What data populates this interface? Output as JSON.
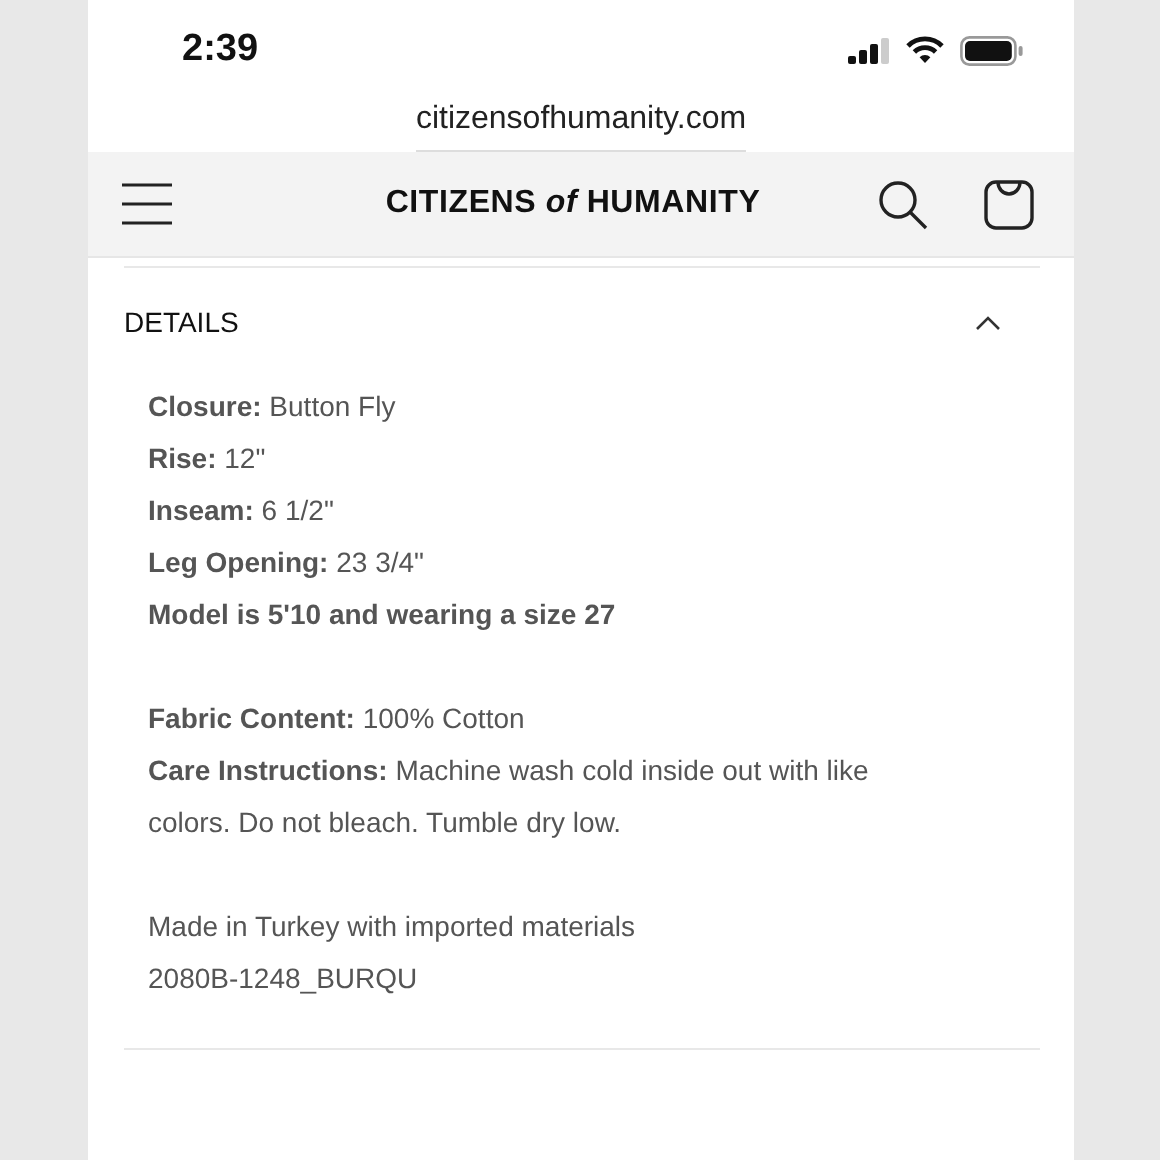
{
  "status_bar": {
    "time": "2:39"
  },
  "browser": {
    "url": "citizensofhumanity.com"
  },
  "header": {
    "logo": "CITIZENS *of* HUMANITY"
  },
  "details": {
    "title": "DETAILS",
    "expanded": true,
    "groups": [
      [
        "**Closure:** Button Fly",
        "**Rise:** 12\"",
        "**Inseam:** 6 1/2\"",
        "**Leg Opening:** 23 3/4\"",
        "**Model is 5'10 and wearing a size 27**"
      ],
      [
        "**Fabric Content:** 100% Cotton",
        "**Care Instructions:** Machine wash cold inside out with like colors. Do not bleach. Tumble dry low."
      ],
      [
        "Made in Turkey with imported materials",
        "2080B-1248_BURQU"
      ]
    ]
  }
}
